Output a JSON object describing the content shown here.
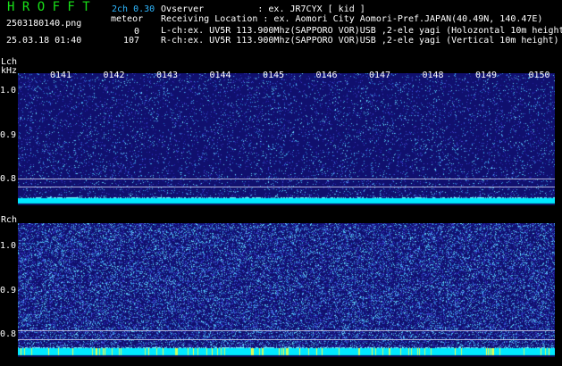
{
  "header": {
    "logo": "H R O F F T",
    "version": "2ch 0.30",
    "filename": "2503180140.png",
    "meteor_label": "meteor",
    "count_lch": "0",
    "datetime": "25.03.18 01:40",
    "count_rch": "107",
    "info_lines": [
      "Ovserver          : ex. JR7CYX [ kid ]",
      "Receiving Location : ex. Aomori City Aomori-Pref.JAPAN(40.49N, 140.47E)",
      "L-ch:ex. UV5R 113.900Mhz(SAPPORO VOR)USB ,2-ele yagi (Holozontal 10m height)",
      "R-ch:ex. UV5R 113.900Mhz(SAPPORO VOR)USB ,2-ele yagi (Vertical 10m height)"
    ]
  },
  "lch": {
    "label_ch": "Lch",
    "label_unit": "kHz",
    "yticks": [
      "1.0",
      "0.9",
      "0.8"
    ],
    "time_ticks": [
      "0141",
      "0142",
      "0143",
      "0144",
      "0145",
      "0146",
      "0147",
      "0148",
      "0149",
      "0150"
    ]
  },
  "rch": {
    "label_ch": "Rch",
    "yticks": [
      "1.0",
      "0.9",
      "0.8"
    ]
  },
  "colors": {
    "background": "#000000",
    "spectrogram_bg": "#10106e",
    "noise_band": "#00ffff",
    "logo": "#18e018",
    "version": "#2fb8ff"
  }
}
